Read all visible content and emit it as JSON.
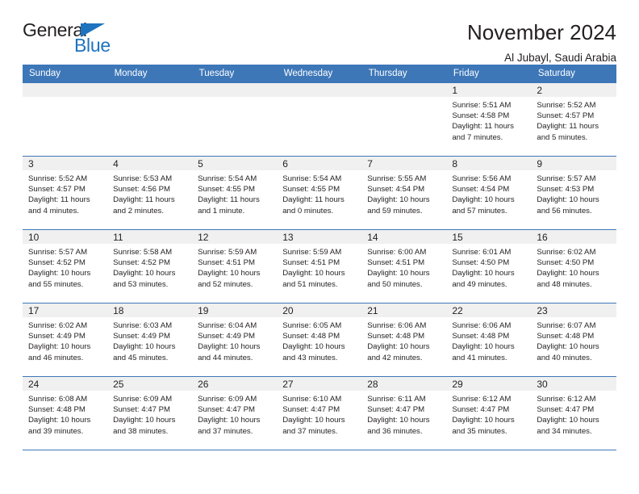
{
  "brand": {
    "name_part1": "General",
    "name_part2": "Blue",
    "triangle_color": "#1e73be"
  },
  "header": {
    "title": "November 2024",
    "subtitle": "Al Jubayl, Saudi Arabia"
  },
  "theme": {
    "header_bg": "#3d77b8",
    "daynum_bg": "#f0f0f0",
    "text": "#231f20"
  },
  "weekdays": [
    "Sunday",
    "Monday",
    "Tuesday",
    "Wednesday",
    "Thursday",
    "Friday",
    "Saturday"
  ],
  "weeks": [
    [
      {
        "day": "",
        "lines": []
      },
      {
        "day": "",
        "lines": []
      },
      {
        "day": "",
        "lines": []
      },
      {
        "day": "",
        "lines": []
      },
      {
        "day": "",
        "lines": []
      },
      {
        "day": "1",
        "lines": [
          "Sunrise: 5:51 AM",
          "Sunset: 4:58 PM",
          "Daylight: 11 hours",
          "and 7 minutes."
        ]
      },
      {
        "day": "2",
        "lines": [
          "Sunrise: 5:52 AM",
          "Sunset: 4:57 PM",
          "Daylight: 11 hours",
          "and 5 minutes."
        ]
      }
    ],
    [
      {
        "day": "3",
        "lines": [
          "Sunrise: 5:52 AM",
          "Sunset: 4:57 PM",
          "Daylight: 11 hours",
          "and 4 minutes."
        ]
      },
      {
        "day": "4",
        "lines": [
          "Sunrise: 5:53 AM",
          "Sunset: 4:56 PM",
          "Daylight: 11 hours",
          "and 2 minutes."
        ]
      },
      {
        "day": "5",
        "lines": [
          "Sunrise: 5:54 AM",
          "Sunset: 4:55 PM",
          "Daylight: 11 hours",
          "and 1 minute."
        ]
      },
      {
        "day": "6",
        "lines": [
          "Sunrise: 5:54 AM",
          "Sunset: 4:55 PM",
          "Daylight: 11 hours",
          "and 0 minutes."
        ]
      },
      {
        "day": "7",
        "lines": [
          "Sunrise: 5:55 AM",
          "Sunset: 4:54 PM",
          "Daylight: 10 hours",
          "and 59 minutes."
        ]
      },
      {
        "day": "8",
        "lines": [
          "Sunrise: 5:56 AM",
          "Sunset: 4:54 PM",
          "Daylight: 10 hours",
          "and 57 minutes."
        ]
      },
      {
        "day": "9",
        "lines": [
          "Sunrise: 5:57 AM",
          "Sunset: 4:53 PM",
          "Daylight: 10 hours",
          "and 56 minutes."
        ]
      }
    ],
    [
      {
        "day": "10",
        "lines": [
          "Sunrise: 5:57 AM",
          "Sunset: 4:52 PM",
          "Daylight: 10 hours",
          "and 55 minutes."
        ]
      },
      {
        "day": "11",
        "lines": [
          "Sunrise: 5:58 AM",
          "Sunset: 4:52 PM",
          "Daylight: 10 hours",
          "and 53 minutes."
        ]
      },
      {
        "day": "12",
        "lines": [
          "Sunrise: 5:59 AM",
          "Sunset: 4:51 PM",
          "Daylight: 10 hours",
          "and 52 minutes."
        ]
      },
      {
        "day": "13",
        "lines": [
          "Sunrise: 5:59 AM",
          "Sunset: 4:51 PM",
          "Daylight: 10 hours",
          "and 51 minutes."
        ]
      },
      {
        "day": "14",
        "lines": [
          "Sunrise: 6:00 AM",
          "Sunset: 4:51 PM",
          "Daylight: 10 hours",
          "and 50 minutes."
        ]
      },
      {
        "day": "15",
        "lines": [
          "Sunrise: 6:01 AM",
          "Sunset: 4:50 PM",
          "Daylight: 10 hours",
          "and 49 minutes."
        ]
      },
      {
        "day": "16",
        "lines": [
          "Sunrise: 6:02 AM",
          "Sunset: 4:50 PM",
          "Daylight: 10 hours",
          "and 48 minutes."
        ]
      }
    ],
    [
      {
        "day": "17",
        "lines": [
          "Sunrise: 6:02 AM",
          "Sunset: 4:49 PM",
          "Daylight: 10 hours",
          "and 46 minutes."
        ]
      },
      {
        "day": "18",
        "lines": [
          "Sunrise: 6:03 AM",
          "Sunset: 4:49 PM",
          "Daylight: 10 hours",
          "and 45 minutes."
        ]
      },
      {
        "day": "19",
        "lines": [
          "Sunrise: 6:04 AM",
          "Sunset: 4:49 PM",
          "Daylight: 10 hours",
          "and 44 minutes."
        ]
      },
      {
        "day": "20",
        "lines": [
          "Sunrise: 6:05 AM",
          "Sunset: 4:48 PM",
          "Daylight: 10 hours",
          "and 43 minutes."
        ]
      },
      {
        "day": "21",
        "lines": [
          "Sunrise: 6:06 AM",
          "Sunset: 4:48 PM",
          "Daylight: 10 hours",
          "and 42 minutes."
        ]
      },
      {
        "day": "22",
        "lines": [
          "Sunrise: 6:06 AM",
          "Sunset: 4:48 PM",
          "Daylight: 10 hours",
          "and 41 minutes."
        ]
      },
      {
        "day": "23",
        "lines": [
          "Sunrise: 6:07 AM",
          "Sunset: 4:48 PM",
          "Daylight: 10 hours",
          "and 40 minutes."
        ]
      }
    ],
    [
      {
        "day": "24",
        "lines": [
          "Sunrise: 6:08 AM",
          "Sunset: 4:48 PM",
          "Daylight: 10 hours",
          "and 39 minutes."
        ]
      },
      {
        "day": "25",
        "lines": [
          "Sunrise: 6:09 AM",
          "Sunset: 4:47 PM",
          "Daylight: 10 hours",
          "and 38 minutes."
        ]
      },
      {
        "day": "26",
        "lines": [
          "Sunrise: 6:09 AM",
          "Sunset: 4:47 PM",
          "Daylight: 10 hours",
          "and 37 minutes."
        ]
      },
      {
        "day": "27",
        "lines": [
          "Sunrise: 6:10 AM",
          "Sunset: 4:47 PM",
          "Daylight: 10 hours",
          "and 37 minutes."
        ]
      },
      {
        "day": "28",
        "lines": [
          "Sunrise: 6:11 AM",
          "Sunset: 4:47 PM",
          "Daylight: 10 hours",
          "and 36 minutes."
        ]
      },
      {
        "day": "29",
        "lines": [
          "Sunrise: 6:12 AM",
          "Sunset: 4:47 PM",
          "Daylight: 10 hours",
          "and 35 minutes."
        ]
      },
      {
        "day": "30",
        "lines": [
          "Sunrise: 6:12 AM",
          "Sunset: 4:47 PM",
          "Daylight: 10 hours",
          "and 34 minutes."
        ]
      }
    ]
  ]
}
